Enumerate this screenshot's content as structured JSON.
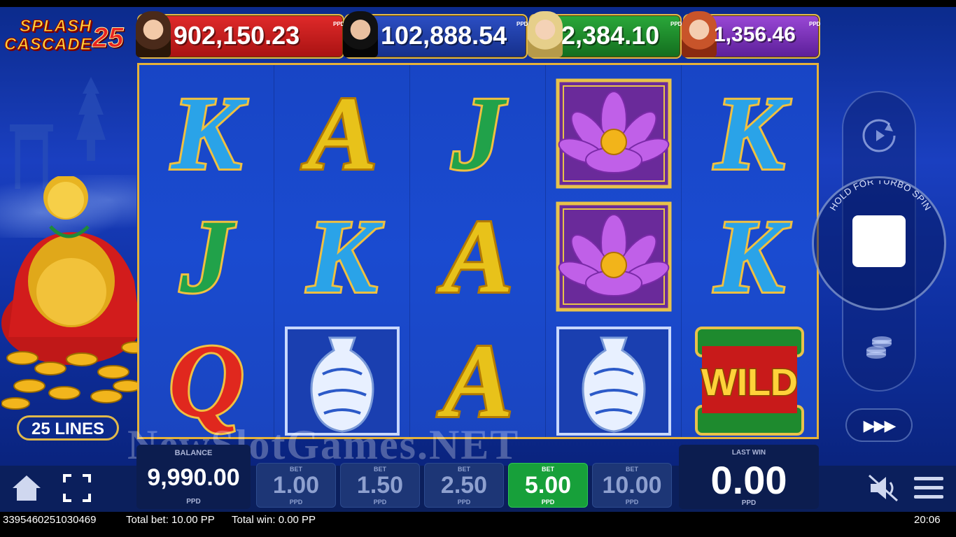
{
  "game": {
    "logo_line1": "SPLASH",
    "logo_line2": "CASCADE",
    "logo_number": "25"
  },
  "jackpots": [
    {
      "value": "902,150.23",
      "currency": "PPD",
      "color": "#c81a1a"
    },
    {
      "value": "102,888.54",
      "currency": "PPD",
      "color": "#1d3a9a"
    },
    {
      "value": "2,384.10",
      "currency": "PPD",
      "color": "#1c8a2a"
    },
    {
      "value": "1,356.46",
      "currency": "PPD",
      "color": "#7a2fb8"
    }
  ],
  "lines_label": "25 LINES",
  "reels": [
    [
      "K",
      "J",
      "Q"
    ],
    [
      "A",
      "K",
      "vase"
    ],
    [
      "J",
      "A",
      "A"
    ],
    [
      "lotus",
      "lotus",
      "vase"
    ],
    [
      "K",
      "K",
      "wild"
    ]
  ],
  "wild_text": "WILD",
  "controls": {
    "turbo_label": "HOLD FOR TURBO SPIN",
    "fast_forward": "▶▶▶"
  },
  "balance": {
    "label": "BALANCE",
    "value": "9,990.00",
    "currency": "PPD"
  },
  "bets": [
    {
      "label": "BET",
      "value": "1.00",
      "currency": "PPD",
      "selected": false
    },
    {
      "label": "BET",
      "value": "1.50",
      "currency": "PPD",
      "selected": false
    },
    {
      "label": "BET",
      "value": "2.50",
      "currency": "PPD",
      "selected": false
    },
    {
      "label": "BET",
      "value": "5.00",
      "currency": "PPD",
      "selected": true
    },
    {
      "label": "BET",
      "value": "10.00",
      "currency": "PPD",
      "selected": false
    }
  ],
  "last_win": {
    "label": "LAST WIN",
    "value": "0.00",
    "currency": "PPD"
  },
  "watermark": "NewSlotGames.NET",
  "status_bar": {
    "round_id": "3395460251030469",
    "total_bet": "Total bet: 10.00 PP",
    "total_win": "Total win: 0.00 PP",
    "time": "20:06"
  }
}
